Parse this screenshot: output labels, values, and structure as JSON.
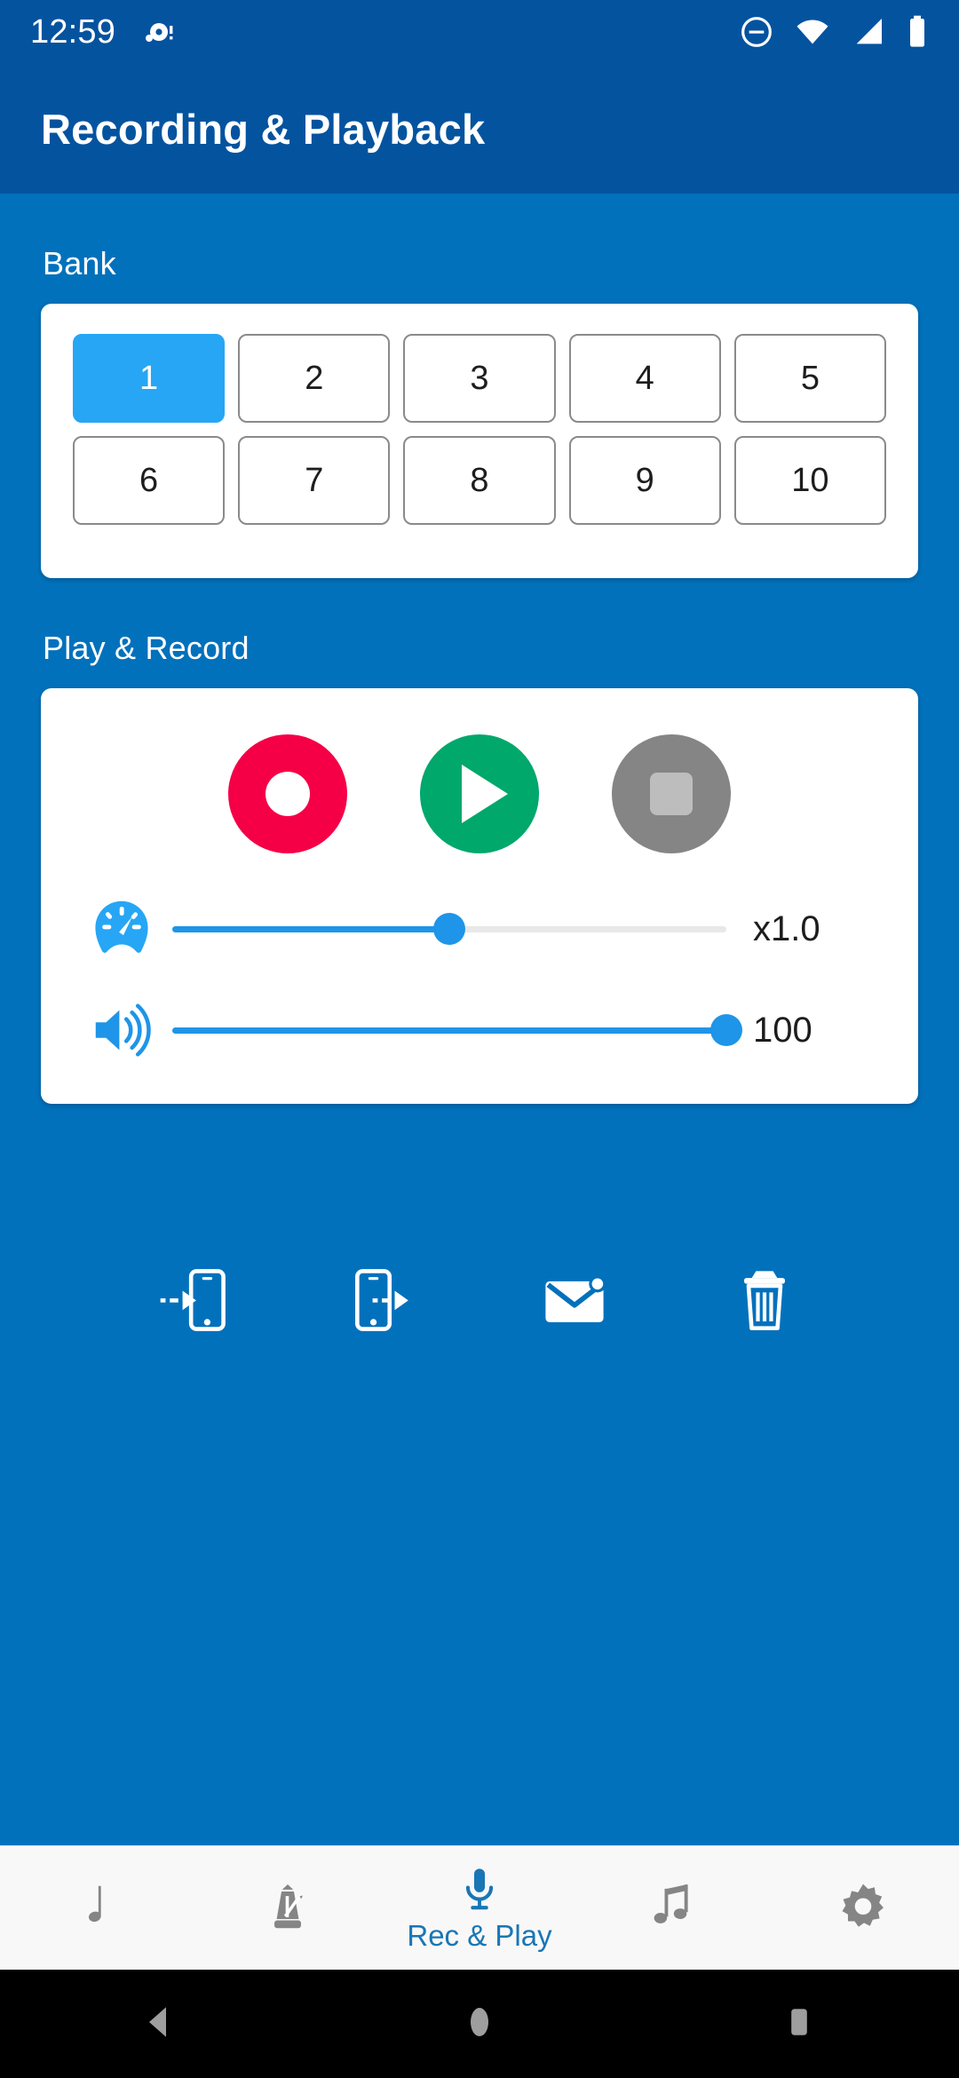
{
  "status_bar": {
    "time": "12:59",
    "left_icons": [
      "notification-dot-icon"
    ],
    "right_icons": [
      "do-not-disturb-icon",
      "wifi-icon",
      "cellular-signal-icon",
      "battery-icon"
    ]
  },
  "app_bar": {
    "title": "Recording & Playback",
    "background_color": "#04539f"
  },
  "theme": {
    "content_background": "#0271bc",
    "accent_blue": "#26a6f5",
    "slider_blue": "#1e95e8",
    "nav_active_blue": "#1976b5",
    "record_red": "#f50046",
    "play_green": "#00a86b",
    "stop_gray": "#858585",
    "card_white": "#ffffff"
  },
  "bank": {
    "label": "Bank",
    "buttons": [
      {
        "label": "1",
        "selected": true
      },
      {
        "label": "2",
        "selected": false
      },
      {
        "label": "3",
        "selected": false
      },
      {
        "label": "4",
        "selected": false
      },
      {
        "label": "5",
        "selected": false
      },
      {
        "label": "6",
        "selected": false
      },
      {
        "label": "7",
        "selected": false
      },
      {
        "label": "8",
        "selected": false
      },
      {
        "label": "9",
        "selected": false
      },
      {
        "label": "10",
        "selected": false
      }
    ]
  },
  "play_record": {
    "label": "Play & Record",
    "transport": [
      {
        "name": "record-button",
        "color": "#f50046"
      },
      {
        "name": "play-button",
        "color": "#00a86b"
      },
      {
        "name": "stop-button",
        "color": "#858585"
      }
    ],
    "speed": {
      "icon": "speedometer-icon",
      "value_label": "x1.0",
      "percent": 50
    },
    "volume": {
      "icon": "volume-up-icon",
      "value_label": "100",
      "percent": 100
    }
  },
  "actions": [
    {
      "name": "import-to-device-icon"
    },
    {
      "name": "export-from-device-icon"
    },
    {
      "name": "email-icon"
    },
    {
      "name": "delete-icon"
    }
  ],
  "bottom_nav": {
    "items": [
      {
        "name": "tab-notes",
        "icon": "eighth-note-icon",
        "label": "",
        "active": false
      },
      {
        "name": "tab-metronome",
        "icon": "metronome-icon",
        "label": "",
        "active": false
      },
      {
        "name": "tab-rec-play",
        "icon": "microphone-icon",
        "label": "Rec & Play",
        "active": true
      },
      {
        "name": "tab-songs",
        "icon": "double-note-icon",
        "label": "",
        "active": false
      },
      {
        "name": "tab-settings",
        "icon": "gear-icon",
        "label": "",
        "active": false
      }
    ]
  },
  "system_nav": {
    "buttons": [
      "back-icon",
      "home-icon",
      "recents-icon"
    ]
  }
}
